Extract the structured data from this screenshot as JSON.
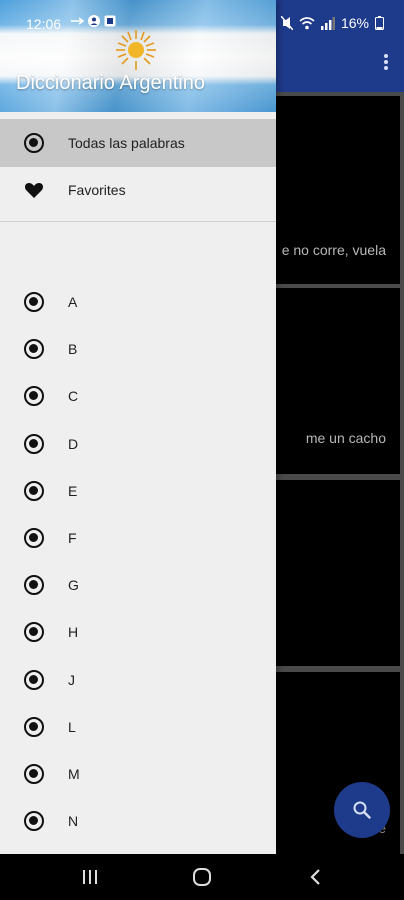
{
  "status_bar": {
    "time": "12:06",
    "battery": "16%"
  },
  "drawer": {
    "title": "Diccionario Argentino",
    "items": [
      {
        "label": "Todas las palabras",
        "icon": "radio-icon",
        "active": true
      },
      {
        "label": "Favorites",
        "icon": "heart-icon",
        "active": false
      }
    ],
    "letters": [
      "A",
      "B",
      "C",
      "D",
      "E",
      "F",
      "G",
      "H",
      "J",
      "L",
      "M",
      "N"
    ]
  },
  "background": {
    "cards": [
      {
        "text": "e no corre, vuela"
      },
      {
        "text": "me un cacho"
      },
      {
        "text": ""
      },
      {
        "text": "se"
      }
    ]
  },
  "colors": {
    "primary": "#1e3a8a",
    "drawer_bg": "#efefef",
    "active_item": "#c8c8c8"
  }
}
